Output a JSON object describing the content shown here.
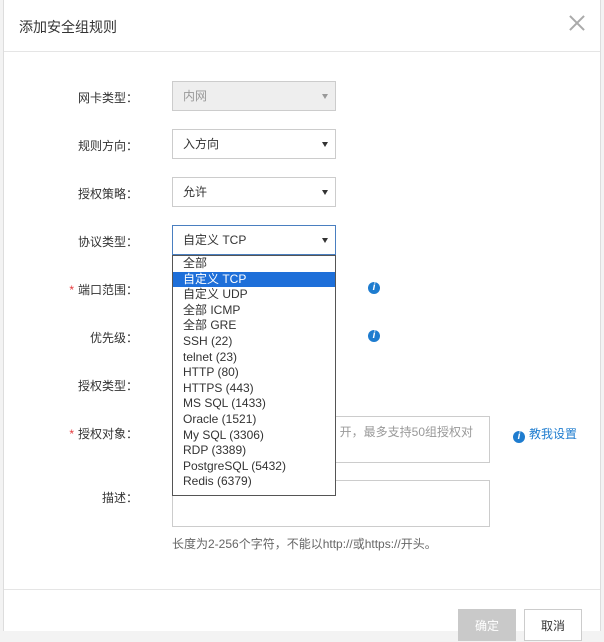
{
  "dialog": {
    "title": "添加安全组规则"
  },
  "form": {
    "nic_type": {
      "label": "网卡类型：",
      "value": "内网"
    },
    "direction": {
      "label": "规则方向：",
      "value": "入方向"
    },
    "policy": {
      "label": "授权策略：",
      "value": "允许"
    },
    "protocol": {
      "label": "协议类型：",
      "value": "自定义 TCP"
    },
    "port_range": {
      "required": "*",
      "label": "端口范围："
    },
    "priority": {
      "label": "优先级："
    },
    "auth_type": {
      "label": "授权类型："
    },
    "auth_object": {
      "required": "*",
      "label": "授权对象：",
      "placeholder_visible": "开，最多支持50组授权对"
    },
    "description": {
      "label": "描述："
    },
    "hint": "长度为2-256个字符，不能以http://或https://开头。",
    "help_link": "教我设置"
  },
  "protocol_options": [
    "全部",
    "自定义 TCP",
    "自定义 UDP",
    "全部 ICMP",
    "全部 GRE",
    "SSH (22)",
    "telnet (23)",
    "HTTP (80)",
    "HTTPS (443)",
    "MS SQL (1433)",
    "Oracle (1521)",
    "My SQL (3306)",
    "RDP (3389)",
    "PostgreSQL (5432)",
    "Redis (6379)"
  ],
  "selected_option_index": 1,
  "footer": {
    "ok": "确定",
    "cancel": "取消"
  },
  "icons": {
    "close": "close-icon",
    "info": "info-icon"
  },
  "colors": {
    "accent": "#1e7ccf",
    "selected": "#1e6fd9",
    "required": "#e4393c"
  }
}
